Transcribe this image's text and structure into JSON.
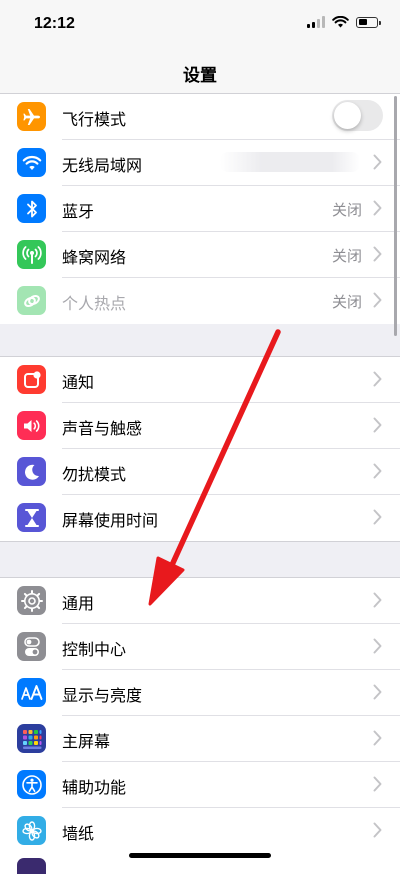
{
  "status": {
    "time": "12:12"
  },
  "nav": {
    "title": "设置"
  },
  "group1": {
    "airplane": {
      "label": "飞行模式",
      "icon": "airplane-icon",
      "color": "#ff9500",
      "toggle_on": false
    },
    "wifi": {
      "label": "无线局域网",
      "icon": "wifi-icon",
      "color": "#007aff"
    },
    "bluetooth": {
      "label": "蓝牙",
      "value": "关闭",
      "icon": "bluetooth-icon",
      "color": "#007aff"
    },
    "cellular": {
      "label": "蜂窝网络",
      "value": "关闭",
      "icon": "antenna-icon",
      "color": "#34c759"
    },
    "hotspot": {
      "label": "个人热点",
      "value": "关闭",
      "icon": "link-chain-icon",
      "color": "#34c759"
    }
  },
  "group2": {
    "notifications": {
      "label": "通知",
      "icon": "notification-badge-icon",
      "color": "#ff3b30"
    },
    "sounds": {
      "label": "声音与触感",
      "icon": "speaker-icon",
      "color": "#ff2d55"
    },
    "dnd": {
      "label": "勿扰模式",
      "icon": "moon-icon",
      "color": "#5856d6"
    },
    "screentime": {
      "label": "屏幕使用时间",
      "icon": "hourglass-icon",
      "color": "#5856d6"
    }
  },
  "group3": {
    "general": {
      "label": "通用",
      "icon": "gear-icon",
      "color": "#8e8e93"
    },
    "control": {
      "label": "控制中心",
      "icon": "toggles-icon",
      "color": "#8e8e93"
    },
    "display": {
      "label": "显示与亮度",
      "icon": "text-size-icon",
      "color": "#007aff"
    },
    "home": {
      "label": "主屏幕",
      "icon": "app-grid-icon",
      "color": "#2c3e9e"
    },
    "accessibility": {
      "label": "辅助功能",
      "icon": "accessibility-icon",
      "color": "#007aff"
    },
    "wallpaper": {
      "label": "墙纸",
      "icon": "flower-icon",
      "color": "#32ade6"
    }
  },
  "annotation": {
    "arrow_color": "#e8191d"
  }
}
